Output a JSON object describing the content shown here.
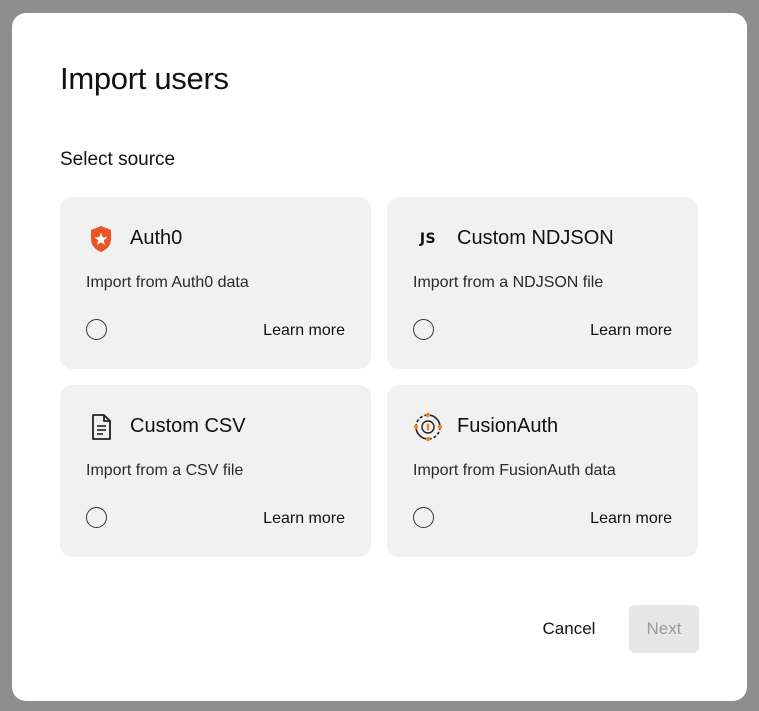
{
  "dialog": {
    "title": "Import users",
    "subtitle": "Select source"
  },
  "sources": [
    {
      "name": "Auth0",
      "description": "Import from Auth0 data",
      "link": "Learn more",
      "icon": "auth0-logo-icon",
      "selected": false
    },
    {
      "name": "Custom NDJSON",
      "description": "Import from a NDJSON file",
      "link": "Learn more",
      "icon": "js-icon",
      "icon_text": "JS",
      "selected": false
    },
    {
      "name": "Custom CSV",
      "description": "Import from a CSV file",
      "link": "Learn more",
      "icon": "document-icon",
      "selected": false
    },
    {
      "name": "FusionAuth",
      "description": "Import from FusionAuth data",
      "link": "Learn more",
      "icon": "fusionauth-logo-icon",
      "selected": false
    }
  ],
  "footer": {
    "cancel_label": "Cancel",
    "next_label": "Next",
    "next_enabled": false
  },
  "colors": {
    "auth0_brand": "#eb5424",
    "fusionauth_brand": "#f58320",
    "card_bg": "#f1f1f1",
    "next_disabled_bg": "#e6e6e6"
  }
}
